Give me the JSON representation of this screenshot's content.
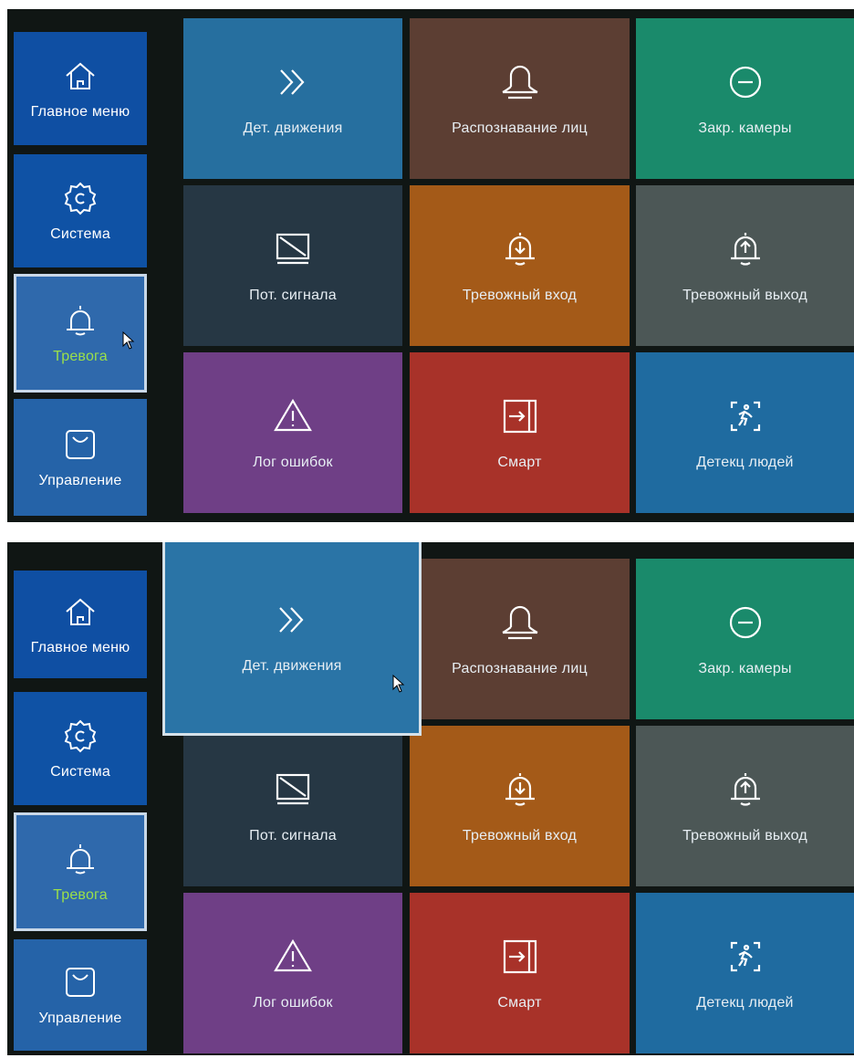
{
  "sidebar": {
    "items": [
      {
        "label": "Главное меню",
        "icon": "home-icon"
      },
      {
        "label": "Система",
        "icon": "gear-icon"
      },
      {
        "label": "Тревога",
        "icon": "bell-icon",
        "selected": true
      },
      {
        "label": "Управление",
        "icon": "bag-icon"
      }
    ],
    "selected_label_color": "#9be04a"
  },
  "tiles": [
    {
      "label": "Дет. движения",
      "icon": "double-chevron-icon",
      "color": "#266f9f"
    },
    {
      "label": "Распознавание лиц",
      "icon": "face-icon",
      "color": "#5c3e33"
    },
    {
      "label": "Закр. камеры",
      "icon": "minus-circle-icon",
      "color": "#1a8a6b"
    },
    {
      "label": "Пот. сигнала",
      "icon": "no-signal-monitor-icon",
      "color": "#263744"
    },
    {
      "label": "Тревожный вход",
      "icon": "bell-in-icon",
      "color": "#a45a18"
    },
    {
      "label": "Тревожный выход",
      "icon": "bell-out-icon",
      "color": "#4c5756"
    },
    {
      "label": "Лог ошибок",
      "icon": "warning-triangle-icon",
      "color": "#6f3f86"
    },
    {
      "label": "Смарт",
      "icon": "enter-box-icon",
      "color": "#a83229"
    },
    {
      "label": "Детекц людей",
      "icon": "person-detect-icon",
      "color": "#1f6ba0"
    }
  ],
  "screens": [
    {
      "name": "default-state"
    },
    {
      "name": "hover-state",
      "hovered_tile": "Дет. движения"
    }
  ]
}
